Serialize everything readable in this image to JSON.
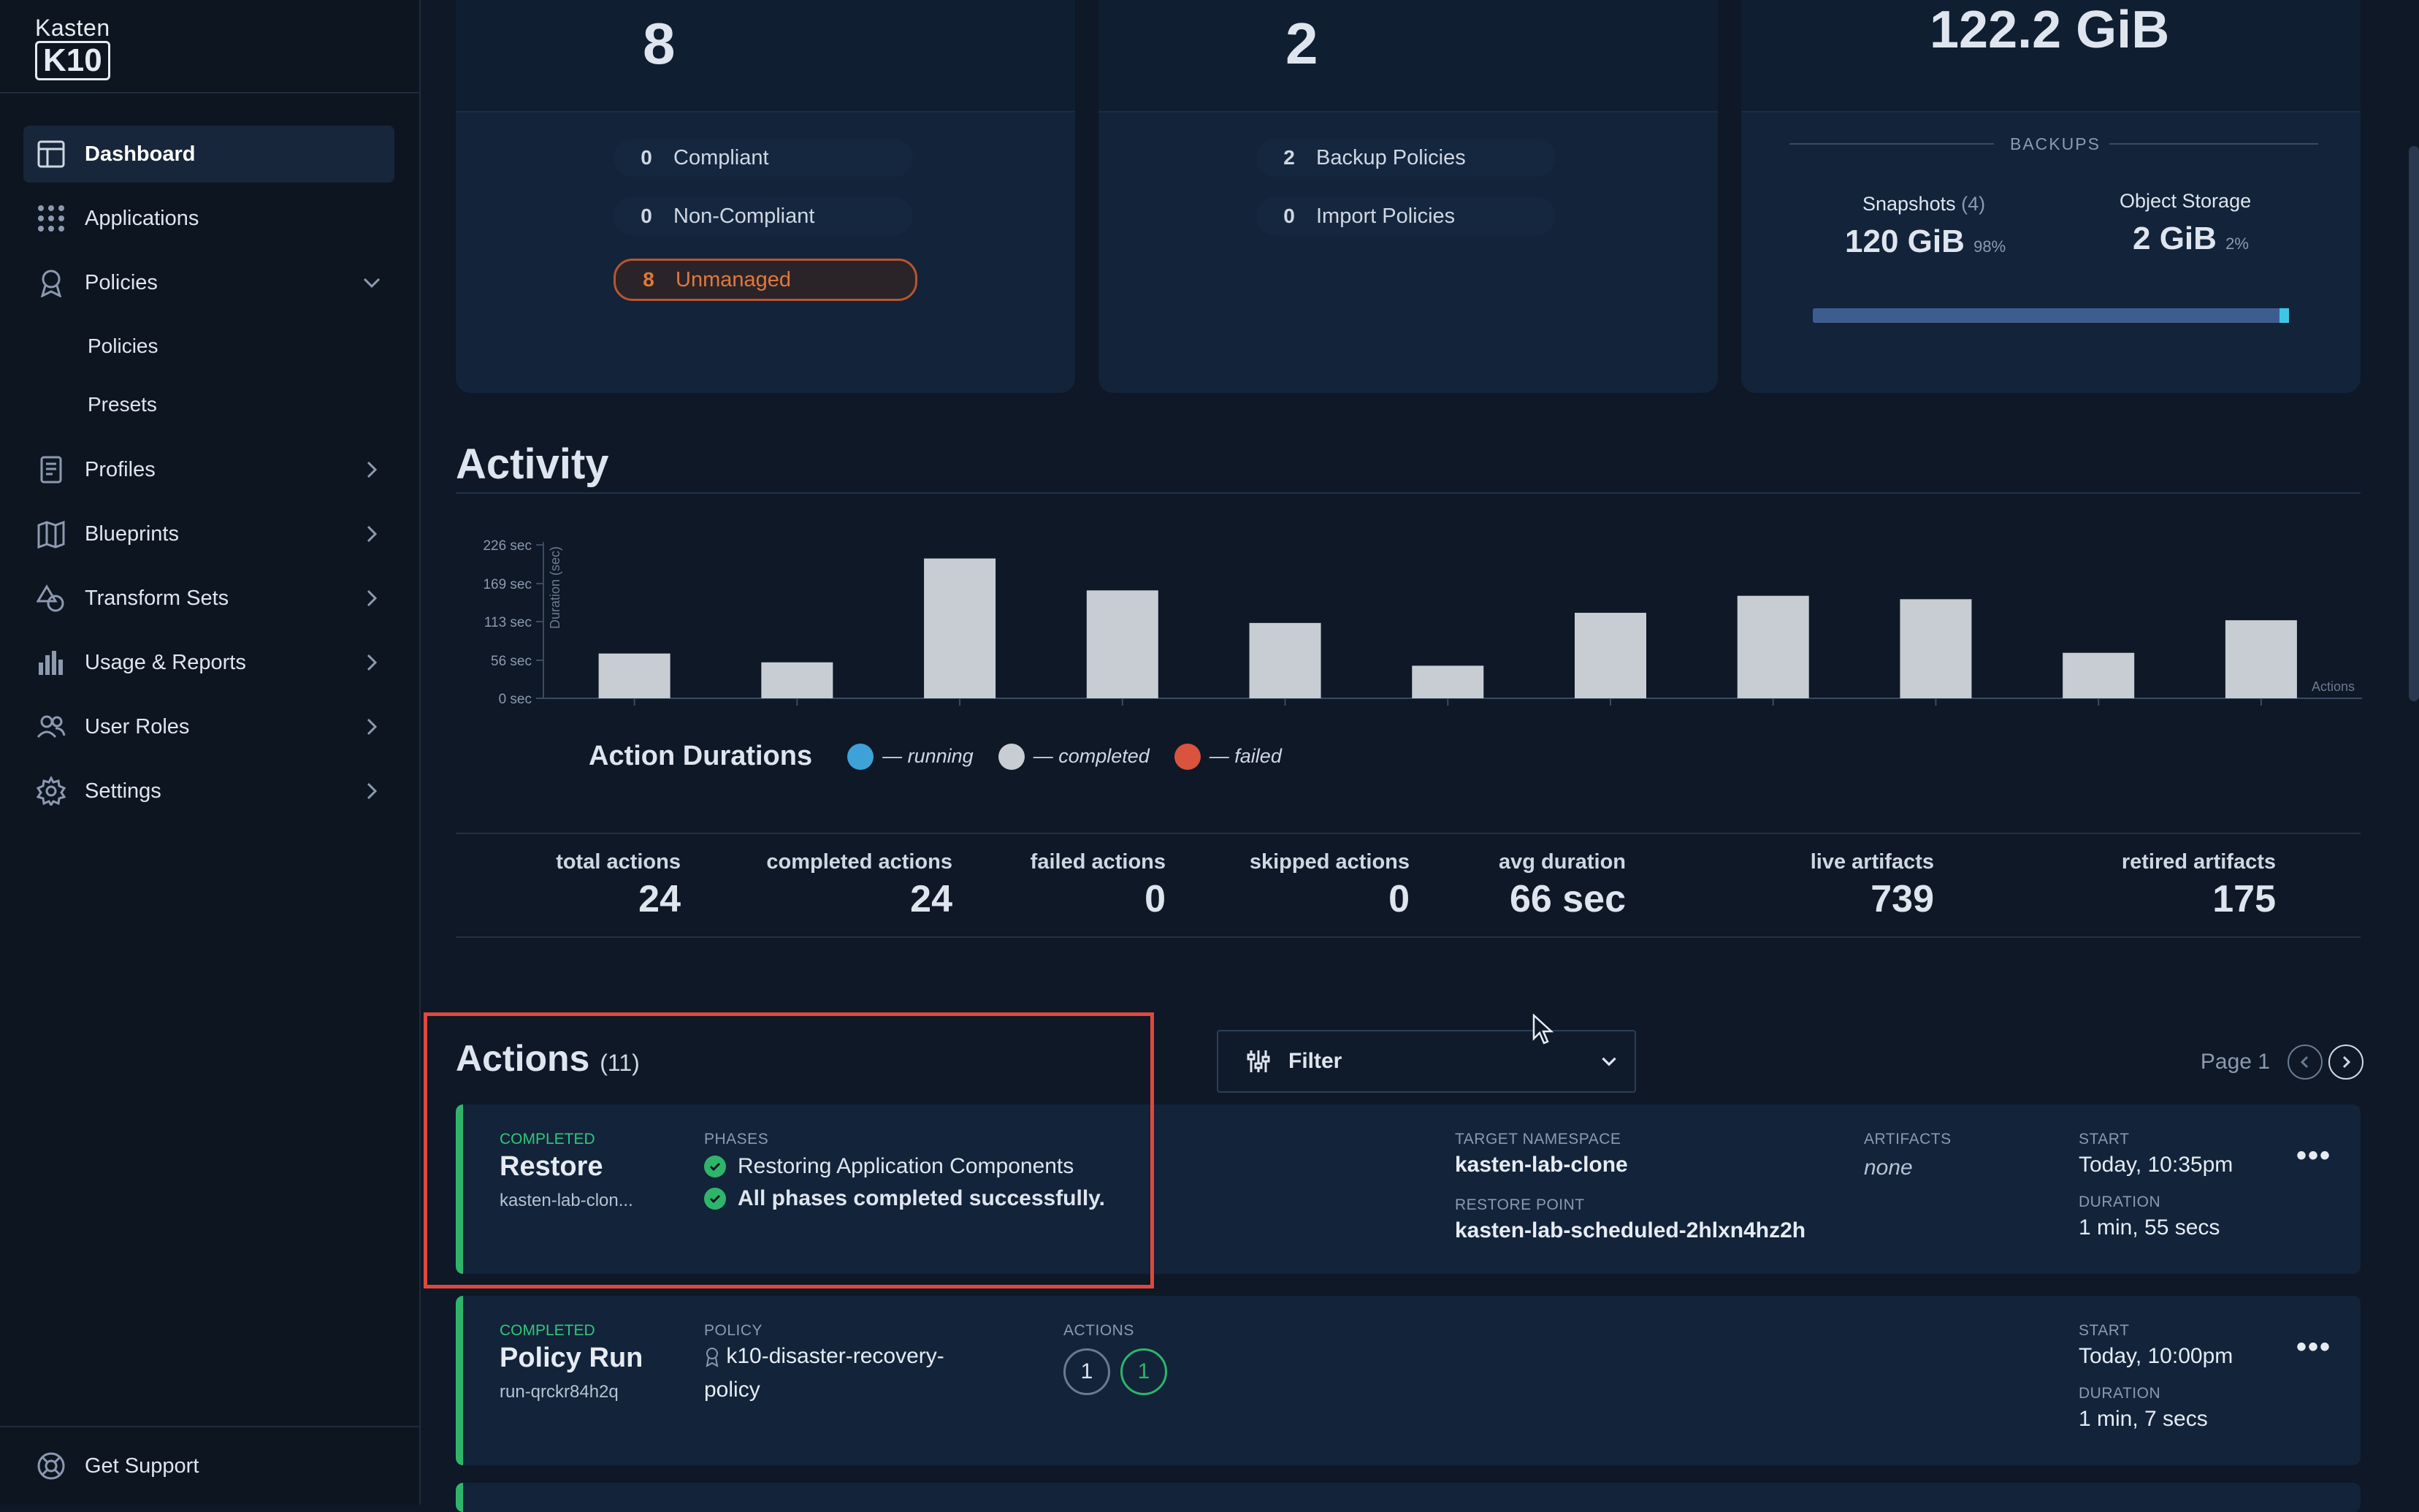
{
  "app": {
    "logo_top": "Kasten",
    "logo_bottom": "K10"
  },
  "sidebar": {
    "items": [
      {
        "label": "Dashboard",
        "icon": "dashboard-icon"
      },
      {
        "label": "Applications",
        "icon": "grid-icon"
      },
      {
        "label": "Policies",
        "icon": "policy-ribbon-icon"
      },
      {
        "label": "Profiles",
        "icon": "profile-doc-icon"
      },
      {
        "label": "Blueprints",
        "icon": "map-icon"
      },
      {
        "label": "Transform Sets",
        "icon": "shapes-icon"
      },
      {
        "label": "Usage & Reports",
        "icon": "bar-chart-icon"
      },
      {
        "label": "User Roles",
        "icon": "users-icon"
      },
      {
        "label": "Settings",
        "icon": "gear-icon"
      }
    ],
    "policies_sub": [
      "Policies",
      "Presets"
    ],
    "support": "Get Support"
  },
  "cards": {
    "apps": {
      "count": "8",
      "compliant_num": "0",
      "compliant": "Compliant",
      "noncompliant_num": "0",
      "noncompliant": "Non-Compliant",
      "unmanaged_num": "8",
      "unmanaged": "Unmanaged"
    },
    "policies": {
      "count": "2",
      "backup_num": "2",
      "backup": "Backup Policies",
      "import_num": "0",
      "import": "Import Policies"
    },
    "data": {
      "total": "122.2 GiB",
      "backups_label": "BACKUPS",
      "snapshots_label": "Snapshots",
      "snapshots_count": "(4)",
      "snapshots_val": "120 GiB",
      "snapshots_pct": "98%",
      "object_label": "Object Storage",
      "object_val": "2 GiB",
      "object_pct": "2%",
      "snapshots_share": 0.98
    }
  },
  "activity": {
    "title": "Activity",
    "legend_title": "Action Durations",
    "legend": [
      {
        "label": "— running",
        "color": "#3ea2d8"
      },
      {
        "label": "— completed",
        "color": "#c8cdd4"
      },
      {
        "label": "— failed",
        "color": "#d9533d"
      }
    ]
  },
  "chart_data": {
    "type": "bar",
    "ylabel": "Duration (sec)",
    "xlabel": "Actions",
    "ylim": [
      0,
      226
    ],
    "yticks": [
      "226 sec",
      "169 sec",
      "113 sec",
      "56 sec",
      "0 sec"
    ],
    "ytick_values": [
      226,
      169,
      113,
      56,
      0
    ],
    "values": [
      66,
      53,
      206,
      159,
      111,
      48,
      126,
      151,
      146,
      67,
      115
    ],
    "bar_color": "#c8cdd4",
    "grid": false
  },
  "stats": [
    {
      "label": "total actions",
      "value": "24"
    },
    {
      "label": "completed actions",
      "value": "24"
    },
    {
      "label": "failed actions",
      "value": "0"
    },
    {
      "label": "skipped actions",
      "value": "0"
    },
    {
      "label": "avg duration",
      "value": "66 sec"
    },
    {
      "label": "live artifacts",
      "value": "739"
    },
    {
      "label": "retired artifacts",
      "value": "175"
    }
  ],
  "actions": {
    "title": "Actions",
    "count": "(11)",
    "filter_label": "Filter",
    "page_label": "Page 1",
    "rows": [
      {
        "status": "COMPLETED",
        "title": "Restore",
        "sub": "kasten-lab-clon...",
        "phases_label": "PHASES",
        "phase1": "Restoring Application Components",
        "phase2": "All phases completed successfully.",
        "target_ns_label": "TARGET NAMESPACE",
        "target_ns": "kasten-lab-clone",
        "restore_point_label": "RESTORE POINT",
        "restore_point": "kasten-lab-scheduled-2hlxn4hz2h",
        "artifacts_label": "ARTIFACTS",
        "artifacts": "none",
        "start_label": "START",
        "start": "Today, 10:35pm",
        "duration_label": "DURATION",
        "duration": "1 min, 55 secs"
      },
      {
        "status": "COMPLETED",
        "title": "Policy Run",
        "sub": "run-qrckr84h2q",
        "policy_label": "POLICY",
        "policy_line1": "k10-disaster-recovery-",
        "policy_line2": "policy",
        "actions_label": "ACTIONS",
        "actions_a": "1",
        "actions_b": "1",
        "start_label": "START",
        "start": "Today, 10:00pm",
        "duration_label": "DURATION",
        "duration": "1 min, 7 secs"
      }
    ]
  }
}
